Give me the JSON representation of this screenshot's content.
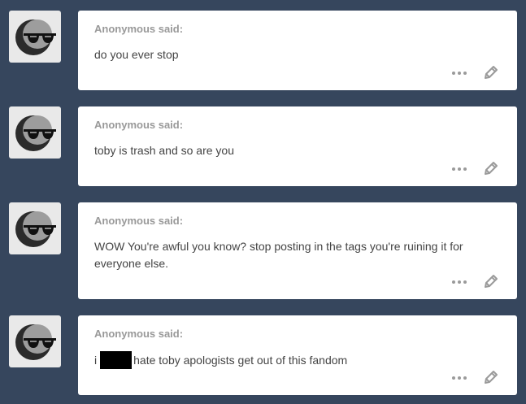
{
  "asks": [
    {
      "asker": "Anonymous said:",
      "message": "do you ever stop",
      "more_icon": "ellipsis-icon",
      "edit_icon": "pencil-icon"
    },
    {
      "asker": "Anonymous said:",
      "message": "toby is trash and so are you",
      "more_icon": "ellipsis-icon",
      "edit_icon": "pencil-icon"
    },
    {
      "asker": "Anonymous said:",
      "message": "WOW You're awful you know? stop posting in the tags you're ruining it for everyone else.",
      "more_icon": "ellipsis-icon",
      "edit_icon": "pencil-icon"
    },
    {
      "asker": "Anonymous said:",
      "message_prefix": "i",
      "message_redacted": true,
      "message": "hate toby apologists get out of this fandom",
      "more_icon": "ellipsis-icon",
      "edit_icon": "pencil-icon"
    }
  ],
  "colors": {
    "background": "#36465d",
    "card": "#ffffff",
    "asker_text": "#999999",
    "message_text": "#444444",
    "icon": "#9a9a9a"
  }
}
